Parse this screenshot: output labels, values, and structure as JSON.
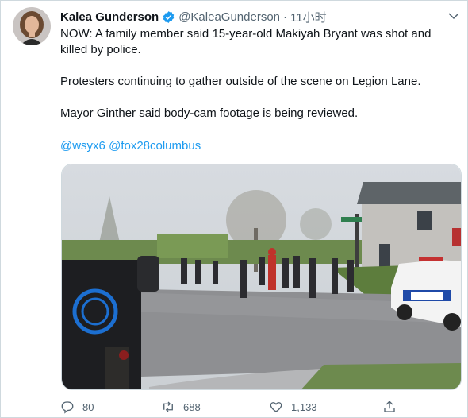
{
  "author": {
    "name": "Kalea Gunderson",
    "handle": "@KaleaGunderson",
    "separator": "·",
    "time": "11小时"
  },
  "tweet": {
    "para1": "NOW: A family member said 15-year-old Makiyah Bryant was shot and killed by police.",
    "para2": "Protesters continuing to gather outside of the scene on Legion Lane.",
    "para3": "Mayor Ginther said body-cam footage is being reviewed.",
    "mentions": [
      "@wsyx6",
      "@fox28columbus"
    ]
  },
  "actions": {
    "reply_count": "80",
    "retweet_count": "688",
    "like_count": "1,133"
  },
  "colors": {
    "accent": "#1d9bf0",
    "text": "#0f1419",
    "muted": "#536471"
  },
  "icons": {
    "verified": "verified-badge-icon",
    "more": "chevron-down-icon",
    "reply": "reply-icon",
    "retweet": "retweet-icon",
    "like": "heart-icon",
    "share": "share-icon"
  }
}
